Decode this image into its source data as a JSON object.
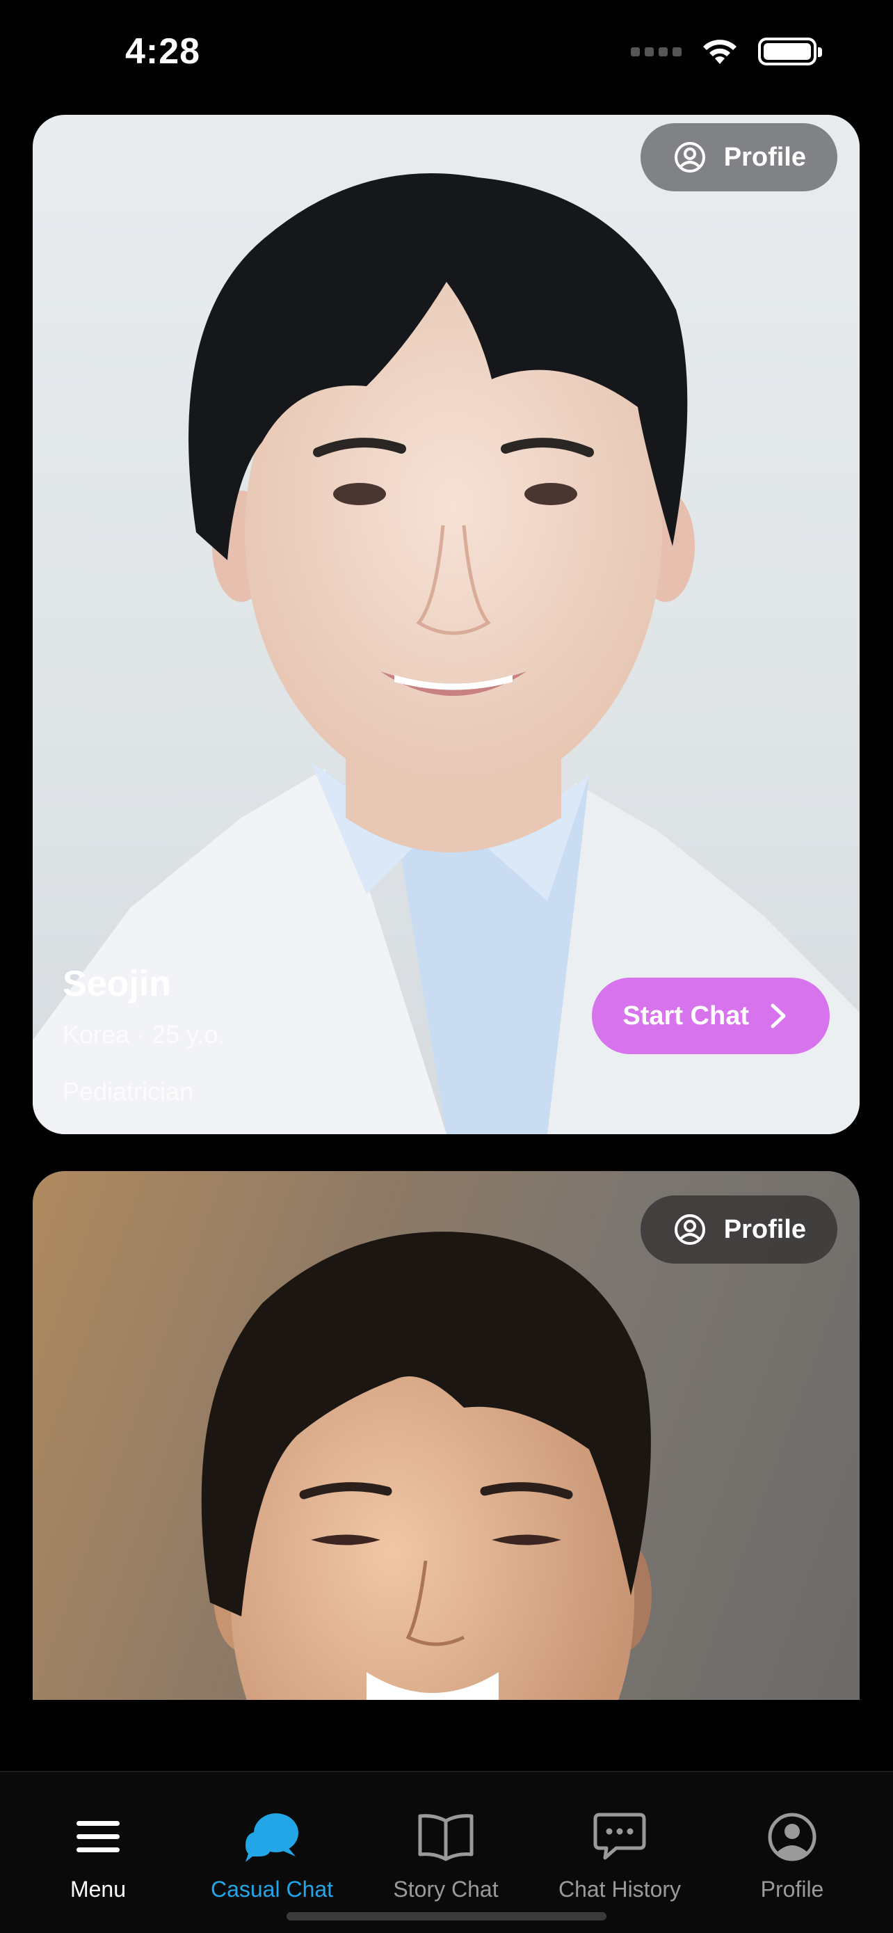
{
  "status_bar": {
    "time": "4:28"
  },
  "cards": [
    {
      "profile_label": "Profile",
      "name": "Seojin",
      "meta": "Korea · 25 y.o.",
      "job": "Pediatrician",
      "start_chat_label": "Start Chat"
    },
    {
      "profile_label": "Profile"
    }
  ],
  "tabbar": {
    "items": [
      {
        "label": "Menu",
        "icon": "hamburger-icon"
      },
      {
        "label": "Casual Chat",
        "icon": "chat-bubbles-icon",
        "active": true
      },
      {
        "label": "Story Chat",
        "icon": "open-book-icon"
      },
      {
        "label": "Chat History",
        "icon": "message-dots-icon"
      },
      {
        "label": "Profile",
        "icon": "user-circle-icon"
      }
    ]
  },
  "colors": {
    "accent_active": "#22a6e8",
    "start_chat": "#d873ee",
    "background": "#000000"
  }
}
